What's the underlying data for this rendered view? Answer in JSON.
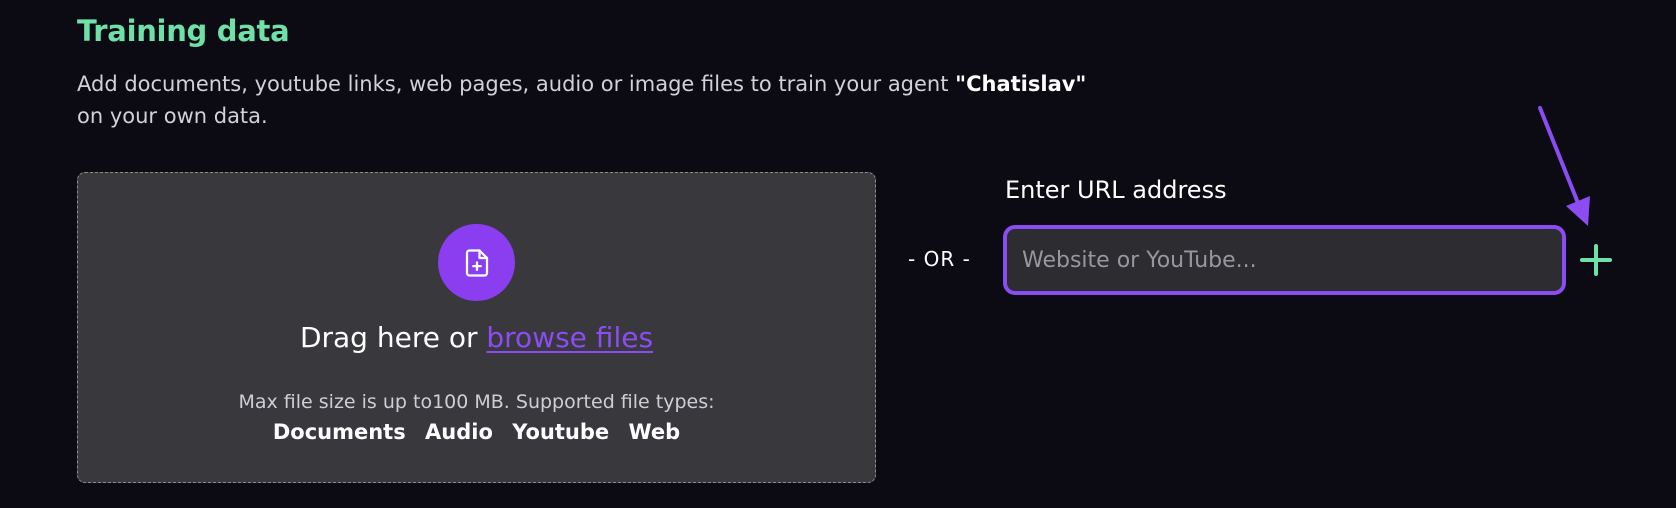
{
  "section": {
    "title": "Training data",
    "description_prefix": "Add documents, youtube links, web pages, audio or image files to train your agent ",
    "agent_name": "\"Chatislav\"",
    "description_suffix": "on your own data."
  },
  "dropzone": {
    "icon": "file-add-icon",
    "drag_text": "Drag here or ",
    "browse_label": "browse files",
    "size_note": "Max file size is up to100 MB. Supported file types:",
    "file_types": [
      "Documents",
      "Audio",
      "Youtube",
      "Web"
    ]
  },
  "separator": {
    "label": "- OR -"
  },
  "url": {
    "label": "Enter URL address",
    "placeholder": "Website or YouTube...",
    "value": ""
  },
  "add_button": {
    "icon": "plus-icon"
  },
  "colors": {
    "accent_green": "#6fe0a8",
    "accent_purple": "#8b4cf2",
    "background": "#0c0a12",
    "dropzone_bg": "#39383d",
    "input_bg": "#2d2c31"
  }
}
